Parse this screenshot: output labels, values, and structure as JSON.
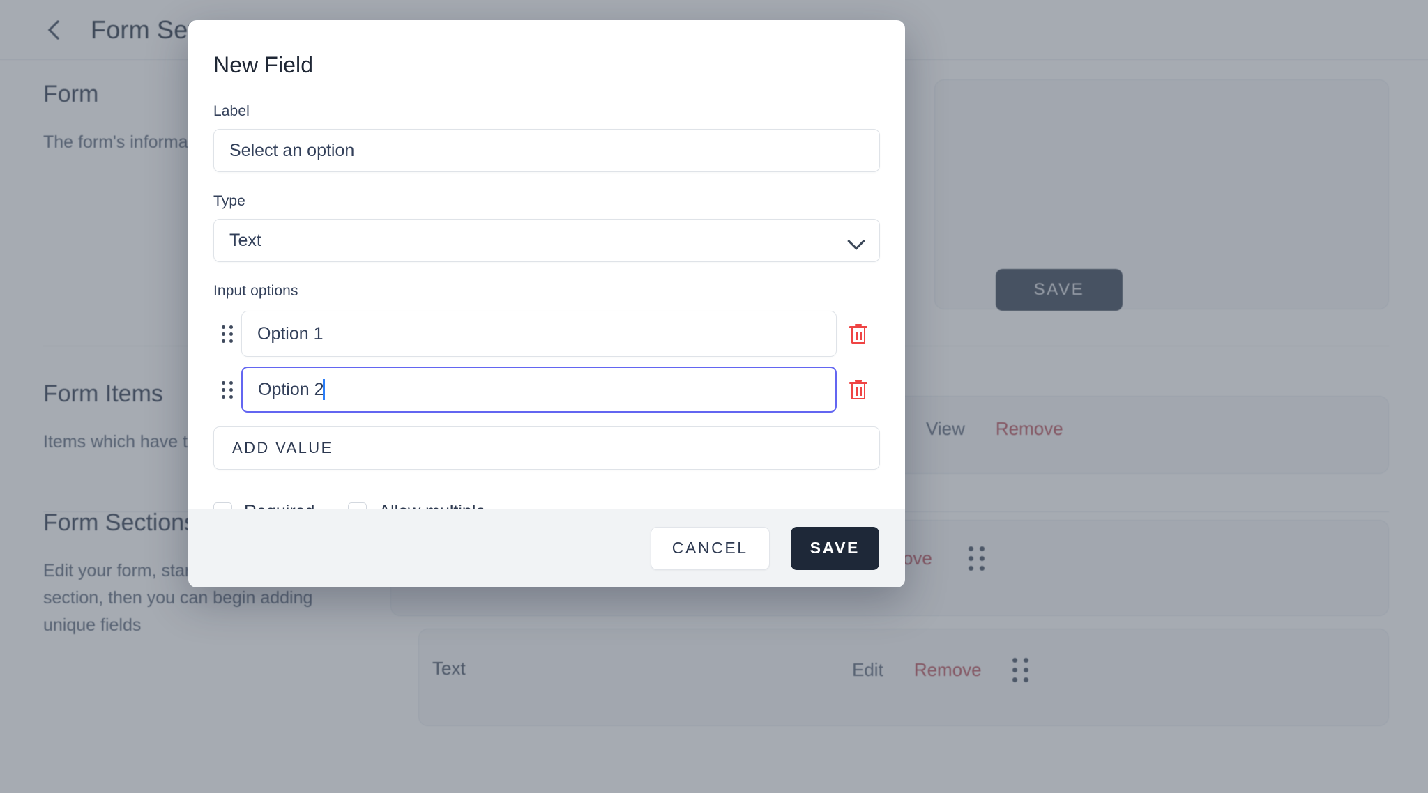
{
  "background": {
    "topbar": {
      "back_icon": "chevron-left-icon",
      "title": "Form Settings"
    },
    "sections": [
      {
        "title": "Form",
        "description": "The form's information",
        "save_label": "SAVE"
      },
      {
        "title": "Form Items",
        "description": "Items which have this form",
        "row_actions": [
          "View",
          "Remove"
        ]
      },
      {
        "title": "Form Sections",
        "description": "Edit your form, start by adding a section, then you can begin adding unique fields",
        "row_actions": [
          "Edit",
          "Remove"
        ],
        "row_type_label": "Text",
        "drag_icon": "drag-handle-icon"
      }
    ]
  },
  "modal": {
    "title": "New Field",
    "label_field": {
      "label": "Label",
      "value": "",
      "placeholder": "Select an option"
    },
    "type_field": {
      "label": "Type",
      "selected": "Text",
      "chevron_icon": "chevron-down-icon"
    },
    "input_options": {
      "label": "Input options",
      "options": [
        {
          "value": "Option 1",
          "focused": false,
          "drag_icon": "drag-handle-icon",
          "delete_icon": "trash-icon"
        },
        {
          "value": "Option 2",
          "focused": true,
          "drag_icon": "drag-handle-icon",
          "delete_icon": "trash-icon"
        }
      ],
      "add_value_label": "ADD VALUE"
    },
    "checkboxes": [
      {
        "label": "Required",
        "checked": false
      },
      {
        "label": "Allow multiple",
        "checked": false
      }
    ],
    "footer": {
      "cancel_label": "CANCEL",
      "save_label": "SAVE"
    }
  },
  "colors": {
    "accent_focus": "#6366f1",
    "danger": "#ef4444",
    "save_dark": "#1e2838",
    "text_primary": "#33405a",
    "scrim": "rgba(61,71,88,0.46)"
  }
}
